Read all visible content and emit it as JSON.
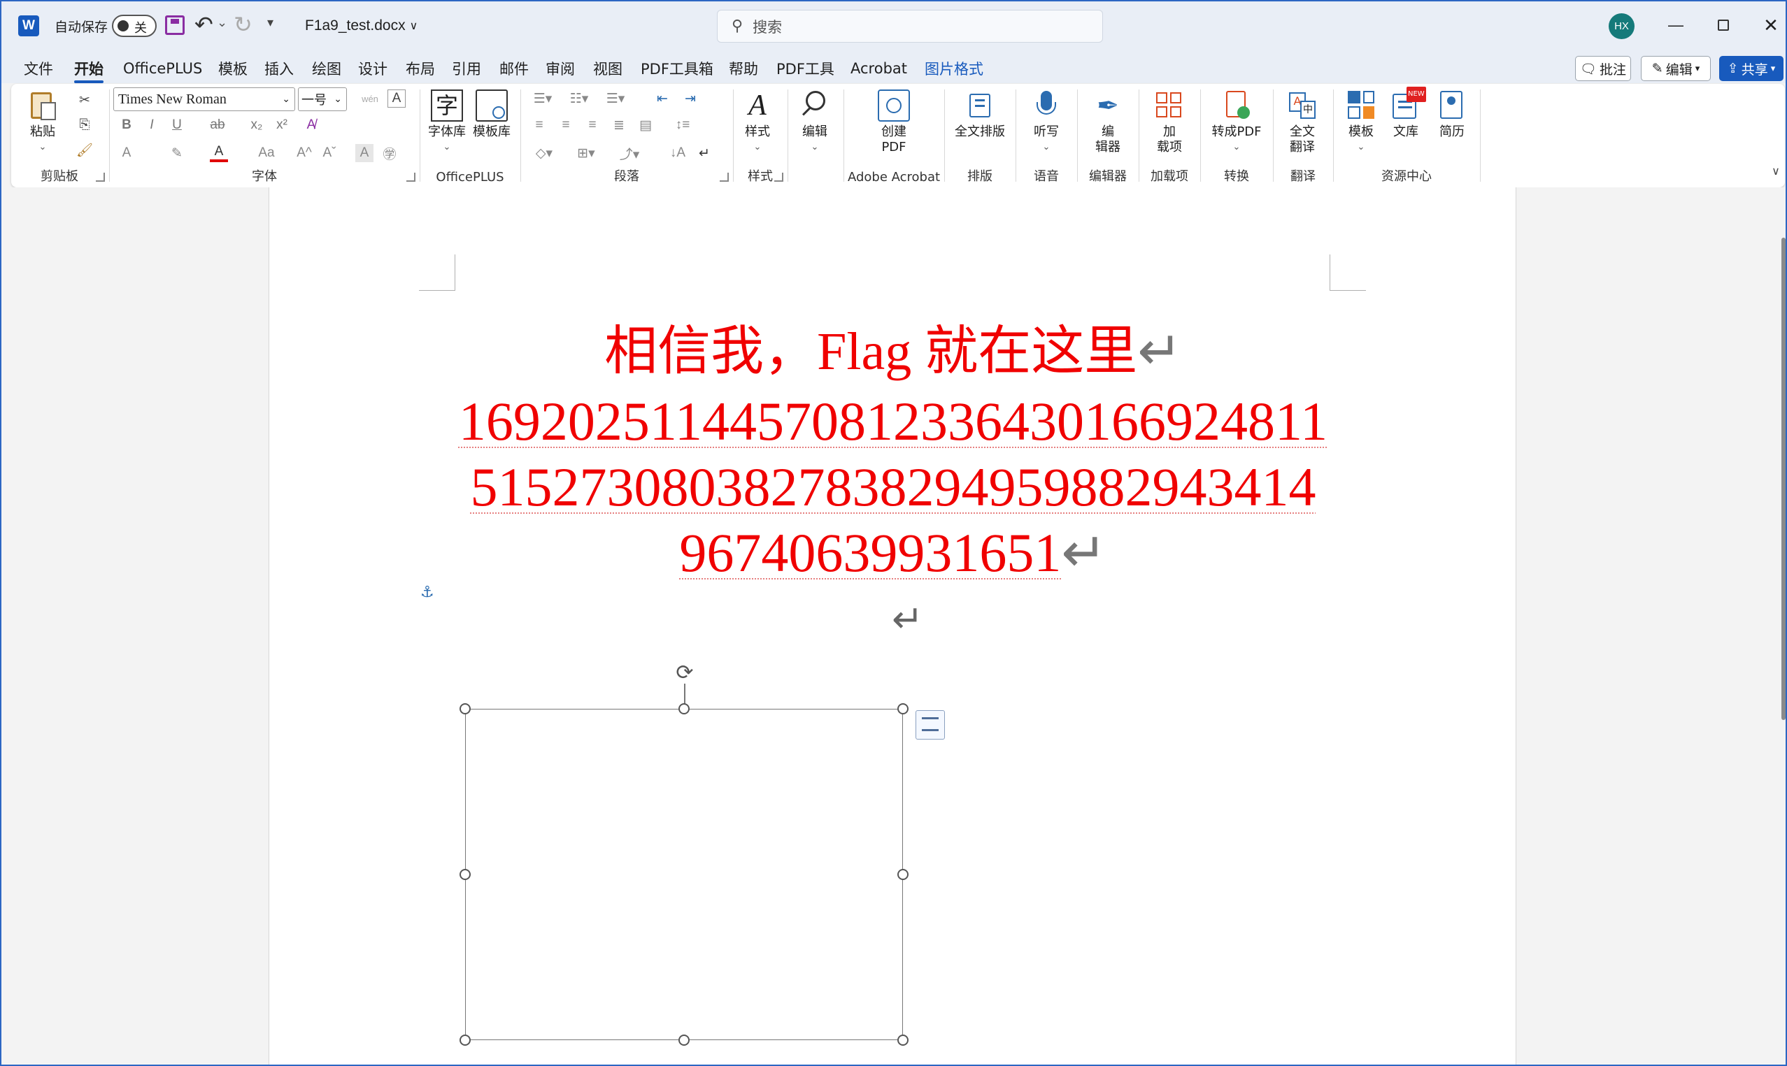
{
  "titlebar": {
    "autosave_label": "自动保存",
    "autosave_state": "关",
    "doc_title": "F1a9_test.docx",
    "search_placeholder": "搜索",
    "avatar_initials": "HX"
  },
  "menu": {
    "tabs": [
      "文件",
      "开始",
      "OfficePLUS",
      "模板",
      "插入",
      "绘图",
      "设计",
      "布局",
      "引用",
      "邮件",
      "审阅",
      "视图",
      "PDF工具箱",
      "帮助",
      "PDF工具",
      "Acrobat",
      "图片格式"
    ],
    "active": "开始",
    "context_tab": "图片格式",
    "comments_label": "批注",
    "editing_label": "编辑",
    "share_label": "共享"
  },
  "ribbon": {
    "clipboard": {
      "paste": "粘贴",
      "label": "剪贴板"
    },
    "font": {
      "name": "Times New Roman",
      "size": "一号",
      "label": "字体"
    },
    "officeplus": {
      "font_lib": "字体库",
      "template_lib": "模板库",
      "label": "OfficePLUS"
    },
    "paragraph": {
      "label": "段落"
    },
    "styles": {
      "btn": "样式",
      "label": "样式"
    },
    "editing": {
      "btn": "编辑"
    },
    "acrobat": {
      "create_pdf": "创建\nPDF",
      "label": "Adobe Acrobat"
    },
    "typeset": {
      "btn": "全文排版",
      "label": "排版"
    },
    "voice": {
      "btn": "听写",
      "label": "语音"
    },
    "editor": {
      "btn": "编\n辑器",
      "label": "编辑器"
    },
    "addins": {
      "btn": "加\n载项",
      "label": "加载项"
    },
    "convert": {
      "btn": "转成PDF",
      "label": "转换"
    },
    "translate": {
      "btn": "全文\n翻译",
      "label": "翻译"
    },
    "resources": {
      "template": "模板",
      "library": "文库",
      "resume": "简历",
      "new_badge": "NEW",
      "label": "资源中心"
    }
  },
  "document": {
    "heading": "相信我，Flag 就在这里",
    "number_lines": [
      "169202511445708123364301669248​11",
      "515273080382783829495988294341​4",
      "96740639931651"
    ]
  },
  "colors": {
    "accent": "#185abd",
    "doc_text": "#f00000",
    "context_tab": "#185abd"
  }
}
